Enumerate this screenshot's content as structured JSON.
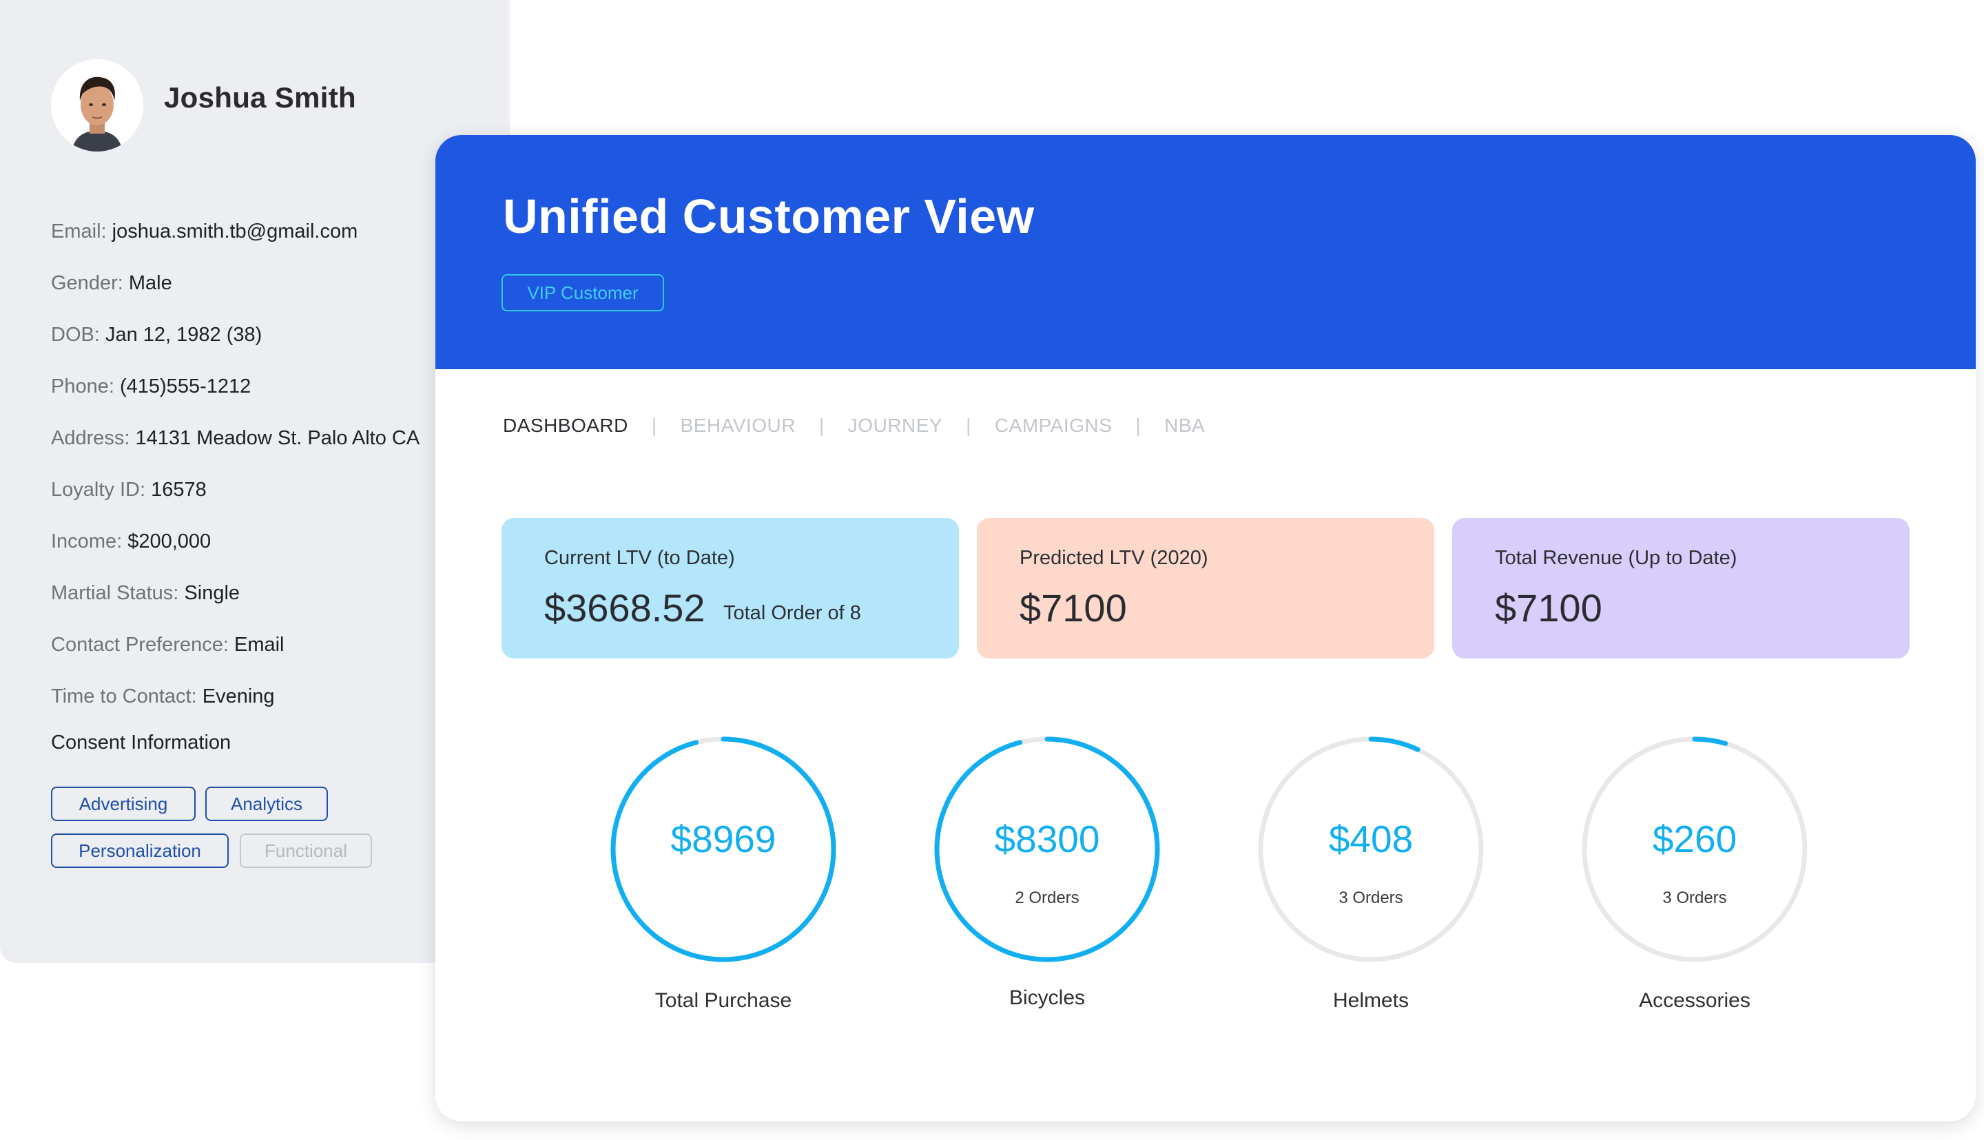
{
  "profile": {
    "name": "Joshua Smith",
    "fields": [
      {
        "label": "Email:",
        "value": "joshua.smith.tb@gmail.com"
      },
      {
        "label": "Gender:",
        "value": "Male"
      },
      {
        "label": "DOB:",
        "value": "Jan 12, 1982 (38)"
      },
      {
        "label": "Phone:",
        "value": "(415)555-1212"
      },
      {
        "label": "Address:",
        "value": "14131 Meadow St. Palo Alto CA"
      },
      {
        "label": "Loyalty ID:",
        "value": "16578"
      },
      {
        "label": "Income:",
        "value": "$200,000"
      },
      {
        "label": "Martial Status:",
        "value": "Single"
      },
      {
        "label": "Contact Preference:",
        "value": "Email"
      },
      {
        "label": "Time to Contact:",
        "value": "Evening"
      }
    ],
    "consent": {
      "title": "Consent Information",
      "tags": [
        {
          "label": "Advertising",
          "active": true
        },
        {
          "label": "Analytics",
          "active": true
        },
        {
          "label": "Personalization",
          "active": true
        },
        {
          "label": "Functional",
          "active": false
        }
      ]
    }
  },
  "main": {
    "title": "Unified Customer View",
    "badge": "VIP Customer",
    "tabs": [
      {
        "label": "DASHBOARD",
        "active": true
      },
      {
        "label": "BEHAVIOUR",
        "active": false
      },
      {
        "label": "JOURNEY",
        "active": false
      },
      {
        "label": "CAMPAIGNS",
        "active": false
      },
      {
        "label": "NBA",
        "active": false
      }
    ],
    "tab_separator": "|",
    "metrics": [
      {
        "label": "Current LTV (to Date)",
        "value": "$3668.52",
        "sub": "Total Order of 8",
        "color": "#b3e6fb"
      },
      {
        "label": "Predicted LTV (2020)",
        "value": "$7100",
        "sub": "",
        "color": "#fdd8cb"
      },
      {
        "label": "Total Revenue (Up to Date)",
        "value": "$7100",
        "sub": "",
        "color": "#d9cdfb"
      }
    ],
    "rings": [
      {
        "amount": "$8969",
        "orders": "",
        "caption": "Total Purchase",
        "progress": 0.96
      },
      {
        "amount": "$8300",
        "orders": "2 Orders",
        "caption": "Bicycles",
        "progress": 0.96
      },
      {
        "amount": "$408",
        "orders": "3 Orders",
        "caption": "Helmets",
        "progress": 0.07
      },
      {
        "amount": "$260",
        "orders": "3 Orders",
        "caption": "Accessories",
        "progress": 0.045
      }
    ],
    "colors": {
      "header": "#1e57e0",
      "ring_progress": "#12aef2",
      "ring_track": "#e8e8e8",
      "tag_border": "#2150a8"
    }
  }
}
